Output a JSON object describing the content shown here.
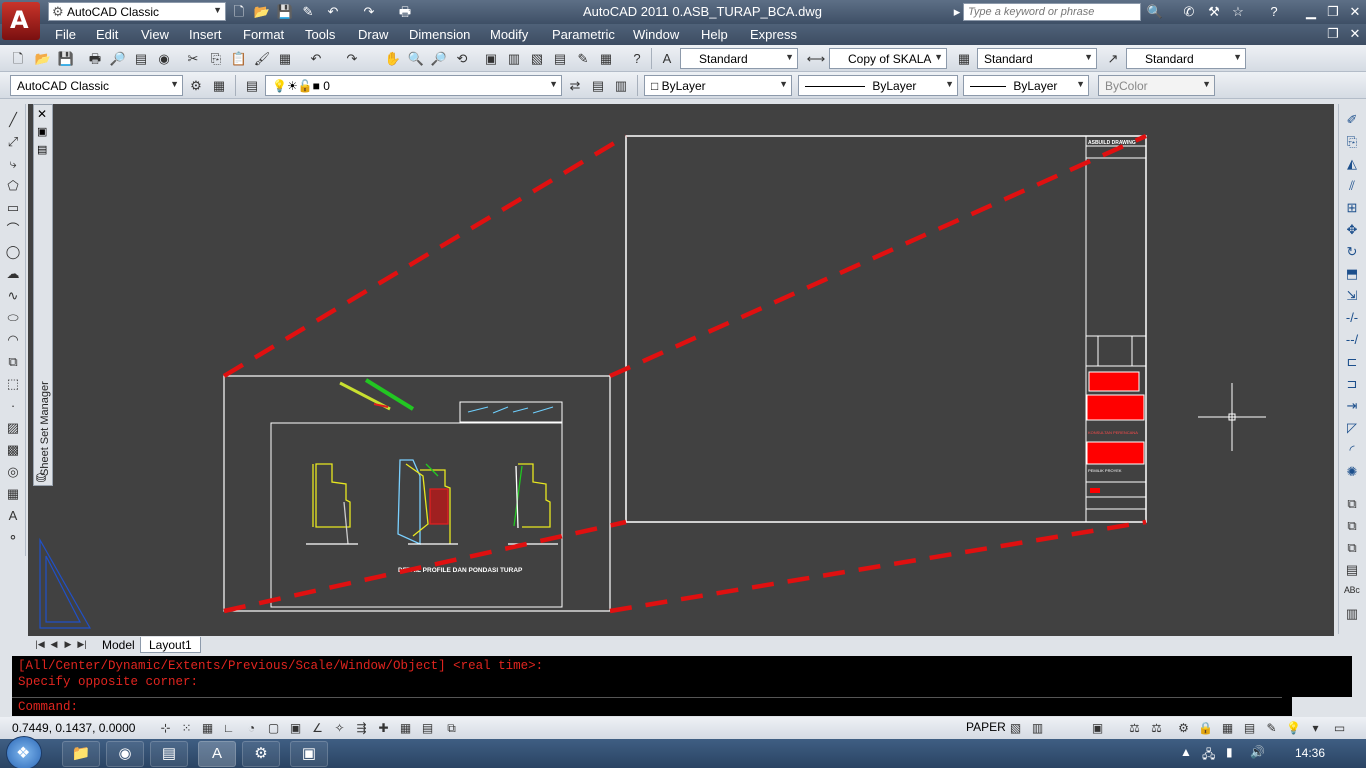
{
  "app": {
    "title": "AutoCAD 2011    0.ASB_TURAP_BCA.dwg",
    "workspace": "AutoCAD Classic",
    "search_placeholder": "Type a keyword or phrase",
    "logo_letter": "A"
  },
  "menu": [
    "File",
    "Edit",
    "View",
    "Insert",
    "Format",
    "Tools",
    "Draw",
    "Dimension",
    "Modify",
    "Parametric",
    "Window",
    "Help",
    "Express"
  ],
  "styles_toolbar": {
    "text_style": "Standard",
    "dim_style": "Copy of SKALA",
    "table_style": "Standard",
    "multileader_style": "Standard"
  },
  "layers_toolbar": {
    "workspace": "AutoCAD Classic",
    "current_layer": "0",
    "color": "ByLayer",
    "linetype": "ByLayer",
    "lineweight": "ByLayer",
    "plot_style": "ByColor"
  },
  "palette": {
    "sheet_set_manager": "Sheet Set Manager"
  },
  "drawing": {
    "detail_caption": "DETAIL PROFILE DAN PONDASI TURAP",
    "titleblock_header": "ASBUILD DRAWING",
    "consultant_label": "KONSULTAN PERENCANA",
    "owner_label": "PEMILIK PROYEK"
  },
  "tabs": [
    "Model",
    "Layout1"
  ],
  "active_tab": "Layout1",
  "command": {
    "history": [
      "[All/Center/Dynamic/Extents/Previous/Scale/Window/Object] <real time>:",
      "Specify opposite corner:"
    ],
    "prompt": "Command:"
  },
  "status": {
    "coordinates": "0.7449, 0.1437, 0.0000",
    "space": "PAPER"
  },
  "taskbar": {
    "time": "14:36"
  },
  "colors": {
    "canvas": "#414141",
    "zoom_marker": "#e01010",
    "command_text": "#e0251f"
  }
}
